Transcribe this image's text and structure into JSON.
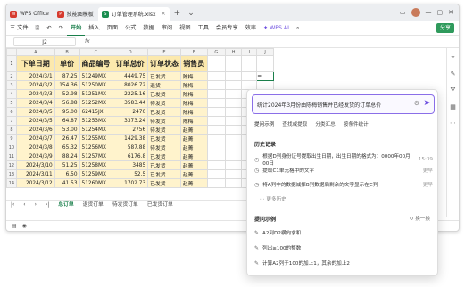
{
  "tabs": [
    {
      "label": "WPS Office",
      "color": "#d63b2f",
      "glyph": "W"
    },
    {
      "label": "技能图模板",
      "color": "#d63b2f",
      "glyph": "P"
    },
    {
      "label": "订单管理系统.xlsx",
      "color": "#1a8d4f",
      "glyph": "S"
    }
  ],
  "menu": {
    "file": "三 文件",
    "items": [
      "开始",
      "插入",
      "页面",
      "公式",
      "数据",
      "审阅",
      "视图",
      "工具",
      "会员专享",
      "效率"
    ],
    "active": "开始",
    "wps_ai": "WPS AI",
    "share": "分享"
  },
  "formula_bar": {
    "cell": "J2",
    "fx": "fx",
    "value": ""
  },
  "columns": [
    "A",
    "B",
    "C",
    "D",
    "E",
    "F",
    "G",
    "H",
    "I",
    "J"
  ],
  "headers": [
    "下单日期",
    "单价",
    "商品编号",
    "订单总价",
    "订单状态",
    "销售员"
  ],
  "rows": [
    [
      "2024/3/1",
      "87.25",
      "51249MX",
      "4449.75",
      "已发货",
      "陈梅"
    ],
    [
      "2024/3/2",
      "154.36",
      "51250MX",
      "8026.72",
      "退货",
      "陈梅"
    ],
    [
      "2024/3/3",
      "52.98",
      "51251MX",
      "2225.16",
      "已发货",
      "陈梅"
    ],
    [
      "2024/3/4",
      "56.88",
      "51252MX",
      "3583.44",
      "待发货",
      "陈梅"
    ],
    [
      "2024/3/5",
      "95.00",
      "62415JX",
      "2470",
      "已发货",
      "陈梅"
    ],
    [
      "2024/3/5",
      "64.87",
      "51253MX",
      "3373.24",
      "待发货",
      "陈梅"
    ],
    [
      "2024/3/6",
      "53.00",
      "51254MX",
      "2756",
      "待发货",
      "赵菁"
    ],
    [
      "2024/3/7",
      "26.47",
      "51255MX",
      "1429.38",
      "已发货",
      "赵菁"
    ],
    [
      "2024/3/8",
      "65.32",
      "51256MX",
      "587.88",
      "待发货",
      "赵菁"
    ],
    [
      "2024/3/9",
      "88.24",
      "51257MX",
      "6176.8",
      "已发货",
      "赵菁"
    ],
    [
      "2024/3/10",
      "51.25",
      "51258MX",
      "3485",
      "已发货",
      "赵菁"
    ],
    [
      "2024/3/11",
      "6.50",
      "51259MX",
      "52.5",
      "已发货",
      "赵菁"
    ],
    [
      "2024/3/12",
      "41.53",
      "51260MX",
      "1702.73",
      "已发货",
      "赵菁"
    ]
  ],
  "row_numbers": [
    "1",
    "2",
    "3",
    "4",
    "5",
    "6",
    "7",
    "8",
    "9",
    "10",
    "11",
    "12",
    "13",
    "14",
    "15"
  ],
  "selected_cell_value": "=",
  "sheets": [
    "总订单",
    "退货订单",
    "待发货订单",
    "已发货订单"
  ],
  "active_sheet": "总订单",
  "ai_panel": {
    "query": "统计2024年3月份由陈梅销售并已经发货的订单总价",
    "chips": [
      "提问示例",
      "查找或提取",
      "分类汇总",
      "按条件统计"
    ],
    "history_title": "历史记录",
    "history": [
      {
        "text": "根据D列身份证号提取出生日期，出生日期的格式为：0000年00月00日",
        "time": "15:39"
      },
      {
        "text": "提取C1单元格中的文字",
        "time": "更早"
      },
      {
        "text": "将A列中的数据减掉B列数据后剩余的文字显示在C列",
        "time": "更早"
      }
    ],
    "more": "更多历史",
    "examples_title": "提问示例",
    "refresh": "换一换",
    "examples": [
      "A2到D2横向求和",
      "列出≥100的整数",
      "计算A2列于100的加上1，其余的加上2"
    ]
  }
}
